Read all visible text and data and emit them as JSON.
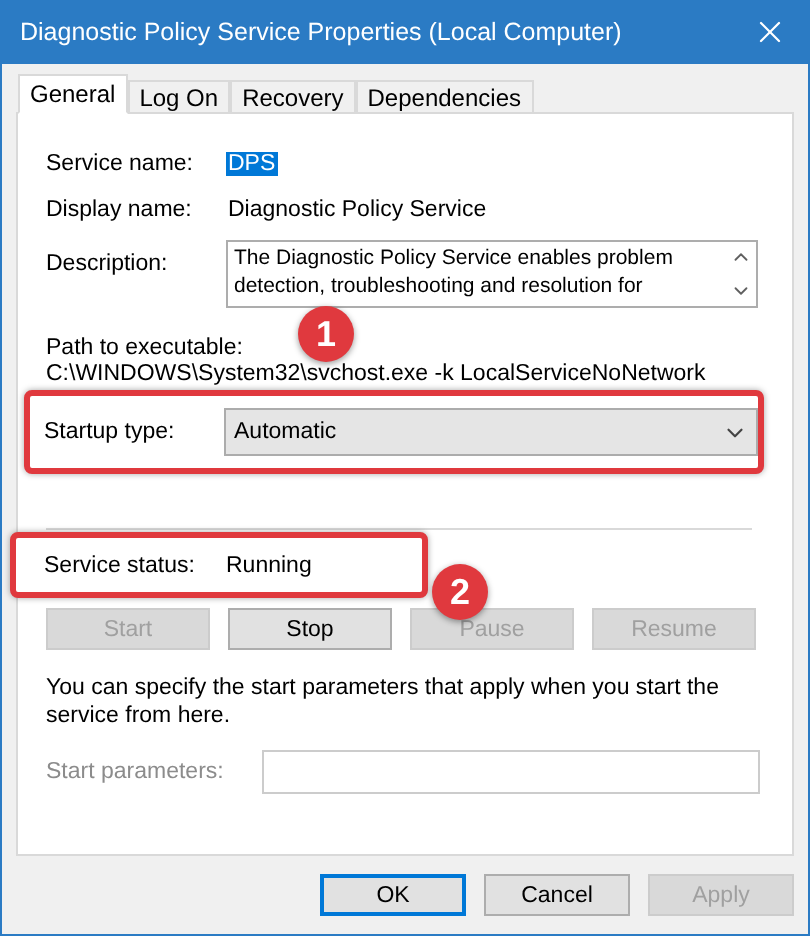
{
  "window": {
    "title": "Diagnostic Policy Service Properties (Local Computer)"
  },
  "tabs": [
    {
      "label": "General",
      "selected": true
    },
    {
      "label": "Log On",
      "selected": false
    },
    {
      "label": "Recovery",
      "selected": false
    },
    {
      "label": "Dependencies",
      "selected": false
    }
  ],
  "service_name": {
    "label": "Service name:",
    "value": "DPS",
    "selected": true
  },
  "display_name": {
    "label": "Display name:",
    "value": "Diagnostic Policy Service"
  },
  "description": {
    "label": "Description:",
    "text": "The Diagnostic Policy Service enables problem detection, troubleshooting and resolution for"
  },
  "path": {
    "label": "Path to executable:",
    "value": "C:\\WINDOWS\\System32\\svchost.exe -k LocalServiceNoNetwork"
  },
  "startup_type": {
    "label": "Startup type:",
    "value": "Automatic",
    "highlighted": true,
    "badge": "1"
  },
  "service_status": {
    "label": "Service status:",
    "value": "Running",
    "highlighted": true,
    "badge": "2"
  },
  "service_buttons": [
    {
      "label": "Start",
      "disabled": true
    },
    {
      "label": "Stop",
      "disabled": false
    },
    {
      "label": "Pause",
      "disabled": true
    },
    {
      "label": "Resume",
      "disabled": true
    }
  ],
  "note": "You can specify the start parameters that apply when you start the service from here.",
  "start_parameters": {
    "label": "Start parameters:",
    "disabled": true
  },
  "dialog_buttons": [
    {
      "label": "OK",
      "default": true,
      "disabled": false
    },
    {
      "label": "Cancel",
      "default": false,
      "disabled": false
    },
    {
      "label": "Apply",
      "default": false,
      "disabled": true
    }
  ]
}
